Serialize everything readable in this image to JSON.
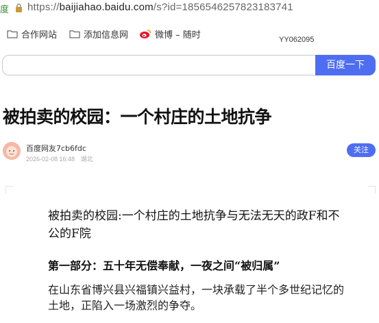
{
  "address_bar": {
    "left_fragment": "度",
    "url_prefix": "https://",
    "url_host": "baijiahao.baidu.com",
    "url_path": "/s?id=1856546257823183741"
  },
  "bookmarks": [
    {
      "label": "合作网站",
      "icon": "folder-icon"
    },
    {
      "label": "添加信息网",
      "icon": "folder-icon"
    },
    {
      "label": "微博 – 随时",
      "icon": "weibo-icon"
    }
  ],
  "stamp": "YY062095",
  "search": {
    "value": "",
    "button_label": "百度一下"
  },
  "article": {
    "title": "被拍卖的校园：一个村庄的土地抗争",
    "author": "百度网友7cb6fdc",
    "date": "2026-02-08 16:48",
    "location": "湖北",
    "follow_label": "关注"
  },
  "content": {
    "heading": "被拍卖的校园:一个村庄的土地抗争与无法无天的政F和不公的F院",
    "section_title": "第一部分：五十年无偿奉献，一夜之间“被归属”",
    "paragraph": "在山东省博兴县兴福镇兴益村，一块承载了半个多世纪记忆的土地，正陷入一场激烈的争夺。"
  },
  "colors": {
    "accent": "#4e6ef2",
    "url_green": "#3a8a3a"
  }
}
